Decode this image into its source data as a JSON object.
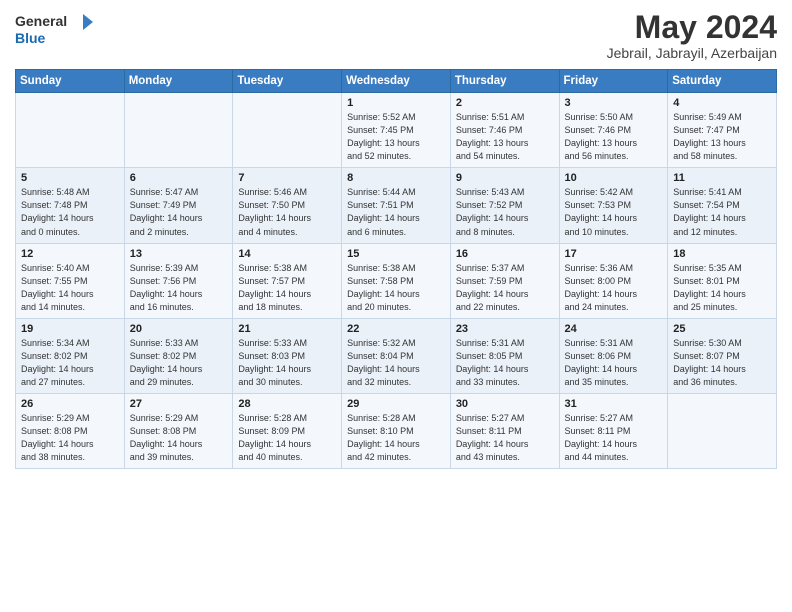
{
  "logo": {
    "line1": "General",
    "line2": "Blue"
  },
  "title": "May 2024",
  "subtitle": "Jebrail, Jabrayil, Azerbaijan",
  "headers": [
    "Sunday",
    "Monday",
    "Tuesday",
    "Wednesday",
    "Thursday",
    "Friday",
    "Saturday"
  ],
  "weeks": [
    [
      {
        "day": "",
        "info": ""
      },
      {
        "day": "",
        "info": ""
      },
      {
        "day": "",
        "info": ""
      },
      {
        "day": "1",
        "info": "Sunrise: 5:52 AM\nSunset: 7:45 PM\nDaylight: 13 hours\nand 52 minutes."
      },
      {
        "day": "2",
        "info": "Sunrise: 5:51 AM\nSunset: 7:46 PM\nDaylight: 13 hours\nand 54 minutes."
      },
      {
        "day": "3",
        "info": "Sunrise: 5:50 AM\nSunset: 7:46 PM\nDaylight: 13 hours\nand 56 minutes."
      },
      {
        "day": "4",
        "info": "Sunrise: 5:49 AM\nSunset: 7:47 PM\nDaylight: 13 hours\nand 58 minutes."
      }
    ],
    [
      {
        "day": "5",
        "info": "Sunrise: 5:48 AM\nSunset: 7:48 PM\nDaylight: 14 hours\nand 0 minutes."
      },
      {
        "day": "6",
        "info": "Sunrise: 5:47 AM\nSunset: 7:49 PM\nDaylight: 14 hours\nand 2 minutes."
      },
      {
        "day": "7",
        "info": "Sunrise: 5:46 AM\nSunset: 7:50 PM\nDaylight: 14 hours\nand 4 minutes."
      },
      {
        "day": "8",
        "info": "Sunrise: 5:44 AM\nSunset: 7:51 PM\nDaylight: 14 hours\nand 6 minutes."
      },
      {
        "day": "9",
        "info": "Sunrise: 5:43 AM\nSunset: 7:52 PM\nDaylight: 14 hours\nand 8 minutes."
      },
      {
        "day": "10",
        "info": "Sunrise: 5:42 AM\nSunset: 7:53 PM\nDaylight: 14 hours\nand 10 minutes."
      },
      {
        "day": "11",
        "info": "Sunrise: 5:41 AM\nSunset: 7:54 PM\nDaylight: 14 hours\nand 12 minutes."
      }
    ],
    [
      {
        "day": "12",
        "info": "Sunrise: 5:40 AM\nSunset: 7:55 PM\nDaylight: 14 hours\nand 14 minutes."
      },
      {
        "day": "13",
        "info": "Sunrise: 5:39 AM\nSunset: 7:56 PM\nDaylight: 14 hours\nand 16 minutes."
      },
      {
        "day": "14",
        "info": "Sunrise: 5:38 AM\nSunset: 7:57 PM\nDaylight: 14 hours\nand 18 minutes."
      },
      {
        "day": "15",
        "info": "Sunrise: 5:38 AM\nSunset: 7:58 PM\nDaylight: 14 hours\nand 20 minutes."
      },
      {
        "day": "16",
        "info": "Sunrise: 5:37 AM\nSunset: 7:59 PM\nDaylight: 14 hours\nand 22 minutes."
      },
      {
        "day": "17",
        "info": "Sunrise: 5:36 AM\nSunset: 8:00 PM\nDaylight: 14 hours\nand 24 minutes."
      },
      {
        "day": "18",
        "info": "Sunrise: 5:35 AM\nSunset: 8:01 PM\nDaylight: 14 hours\nand 25 minutes."
      }
    ],
    [
      {
        "day": "19",
        "info": "Sunrise: 5:34 AM\nSunset: 8:02 PM\nDaylight: 14 hours\nand 27 minutes."
      },
      {
        "day": "20",
        "info": "Sunrise: 5:33 AM\nSunset: 8:02 PM\nDaylight: 14 hours\nand 29 minutes."
      },
      {
        "day": "21",
        "info": "Sunrise: 5:33 AM\nSunset: 8:03 PM\nDaylight: 14 hours\nand 30 minutes."
      },
      {
        "day": "22",
        "info": "Sunrise: 5:32 AM\nSunset: 8:04 PM\nDaylight: 14 hours\nand 32 minutes."
      },
      {
        "day": "23",
        "info": "Sunrise: 5:31 AM\nSunset: 8:05 PM\nDaylight: 14 hours\nand 33 minutes."
      },
      {
        "day": "24",
        "info": "Sunrise: 5:31 AM\nSunset: 8:06 PM\nDaylight: 14 hours\nand 35 minutes."
      },
      {
        "day": "25",
        "info": "Sunrise: 5:30 AM\nSunset: 8:07 PM\nDaylight: 14 hours\nand 36 minutes."
      }
    ],
    [
      {
        "day": "26",
        "info": "Sunrise: 5:29 AM\nSunset: 8:08 PM\nDaylight: 14 hours\nand 38 minutes."
      },
      {
        "day": "27",
        "info": "Sunrise: 5:29 AM\nSunset: 8:08 PM\nDaylight: 14 hours\nand 39 minutes."
      },
      {
        "day": "28",
        "info": "Sunrise: 5:28 AM\nSunset: 8:09 PM\nDaylight: 14 hours\nand 40 minutes."
      },
      {
        "day": "29",
        "info": "Sunrise: 5:28 AM\nSunset: 8:10 PM\nDaylight: 14 hours\nand 42 minutes."
      },
      {
        "day": "30",
        "info": "Sunrise: 5:27 AM\nSunset: 8:11 PM\nDaylight: 14 hours\nand 43 minutes."
      },
      {
        "day": "31",
        "info": "Sunrise: 5:27 AM\nSunset: 8:11 PM\nDaylight: 14 hours\nand 44 minutes."
      },
      {
        "day": "",
        "info": ""
      }
    ]
  ]
}
